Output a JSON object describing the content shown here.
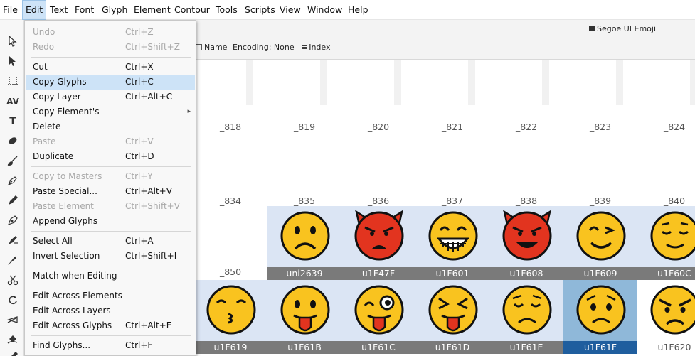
{
  "menubar": {
    "items": [
      "File",
      "Edit",
      "Text",
      "Font",
      "Glyph",
      "Element",
      "Contour",
      "Tools",
      "Scripts",
      "View",
      "Window",
      "Help"
    ],
    "active": "Edit"
  },
  "toolbar": {
    "font_name": "Segoe UI Emoji",
    "name_label": "Name",
    "encoding_label": "Encoding: None",
    "index_label": "Index"
  },
  "edit_menu": [
    {
      "label": "Undo",
      "shortcut": "Ctrl+Z",
      "disabled": true
    },
    {
      "label": "Redo",
      "shortcut": "Ctrl+Shift+Z",
      "disabled": true
    },
    {
      "sep": true
    },
    {
      "label": "Cut",
      "shortcut": "Ctrl+X"
    },
    {
      "label": "Copy Glyphs",
      "shortcut": "Ctrl+C",
      "highlighted": true
    },
    {
      "label": "Copy Layer",
      "shortcut": "Ctrl+Alt+C"
    },
    {
      "label": "Copy Element's",
      "shortcut": "",
      "submenu": true
    },
    {
      "label": "Delete",
      "shortcut": ""
    },
    {
      "label": "Paste",
      "shortcut": "Ctrl+V",
      "disabled": true
    },
    {
      "label": "Duplicate",
      "shortcut": "Ctrl+D"
    },
    {
      "sep": true
    },
    {
      "label": "Copy to Masters",
      "shortcut": "Ctrl+Y",
      "disabled": true
    },
    {
      "label": "Paste Special...",
      "shortcut": "Ctrl+Alt+V"
    },
    {
      "label": "Paste Element",
      "shortcut": "Ctrl+Shift+V",
      "disabled": true
    },
    {
      "label": "Append Glyphs",
      "shortcut": ""
    },
    {
      "sep": true
    },
    {
      "label": "Select All",
      "shortcut": "Ctrl+A"
    },
    {
      "label": "Invert Selection",
      "shortcut": "Ctrl+Shift+I"
    },
    {
      "sep": true
    },
    {
      "label": "Match when Editing",
      "shortcut": ""
    },
    {
      "sep": true
    },
    {
      "label": "Edit Across Elements",
      "shortcut": ""
    },
    {
      "label": "Edit Across Layers",
      "shortcut": ""
    },
    {
      "label": "Edit Across Glyphs",
      "shortcut": "Ctrl+Alt+E"
    },
    {
      "sep": true
    },
    {
      "label": "Find Glyphs...",
      "shortcut": "Ctrl+F"
    }
  ],
  "palette_tools": [
    "pointer-icon",
    "contour-pointer-icon",
    "metrics-icon",
    "kerning-icon",
    "text-icon",
    "eraser-icon",
    "brush-icon",
    "pen-icon",
    "pencil-icon",
    "calligraphy-pen-icon",
    "rapid-tool-icon",
    "knife-icon",
    "scissors-icon",
    "rotate-icon",
    "slant-icon",
    "fill-icon",
    "ruler-icon"
  ],
  "grid": {
    "row1_labels": [
      "_818",
      "_819",
      "_820",
      "_821",
      "_822",
      "_823",
      "_824"
    ],
    "row2_labels": [
      "_834",
      "_835",
      "_836",
      "_837",
      "_838",
      "_839",
      "_840"
    ],
    "row3_labels": [
      "_850",
      "uni2639",
      "u1F47F",
      "u1F601",
      "u1F608",
      "u1F609",
      "u1F60C"
    ],
    "row4_labels": [
      "u1F619",
      "u1F61B",
      "u1F61C",
      "u1F61D",
      "u1F61E",
      "u1F61F",
      "u1F620"
    ],
    "selected": "u1F61F"
  },
  "colors": {
    "emoji_yellow": "#f9c31f",
    "devil_red": "#e2341f",
    "selection_blue": "#1f5e9e",
    "menu_highlight": "#cde3f7"
  }
}
